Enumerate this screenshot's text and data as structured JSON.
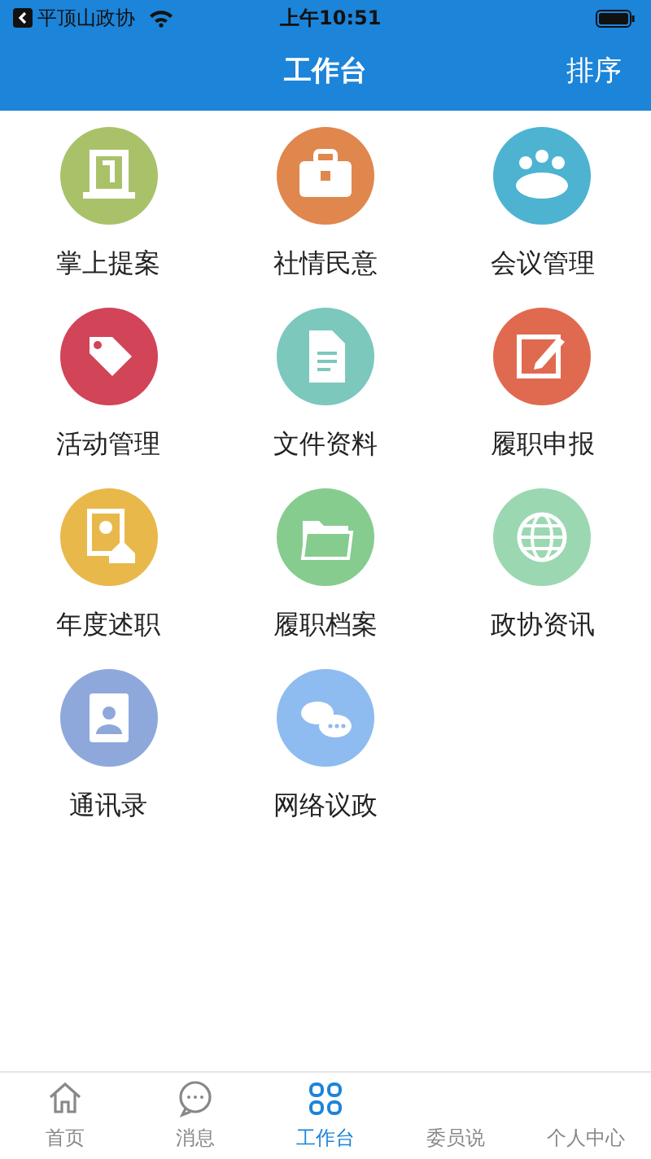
{
  "status_bar": {
    "back_app": "平顶山政协",
    "time": "上午10:51"
  },
  "nav": {
    "title": "工作台",
    "action": "排序"
  },
  "tiles": [
    {
      "label": "掌上提案",
      "kind": "podium",
      "color": "#a9c26a"
    },
    {
      "label": "社情民意",
      "kind": "briefcase",
      "color": "#e0874d"
    },
    {
      "label": "会议管理",
      "kind": "people",
      "color": "#4db3d1"
    },
    {
      "label": "活动管理",
      "kind": "tag",
      "color": "#d24458"
    },
    {
      "label": "文件资料",
      "kind": "document",
      "color": "#7cc8bd"
    },
    {
      "label": "履职申报",
      "kind": "edit",
      "color": "#e06a4f"
    },
    {
      "label": "年度述职",
      "kind": "portrait",
      "color": "#e9b84a"
    },
    {
      "label": "履职档案",
      "kind": "folder",
      "color": "#86cc8e"
    },
    {
      "label": "政协资讯",
      "kind": "globe",
      "color": "#9bd8b2"
    },
    {
      "label": "通讯录",
      "kind": "contacts",
      "color": "#8fa8dc"
    },
    {
      "label": "网络议政",
      "kind": "chat",
      "color": "#8ebbf0"
    }
  ],
  "tab_bar": [
    {
      "label": "首页",
      "kind": "home",
      "selected": false
    },
    {
      "label": "消息",
      "kind": "chat",
      "selected": false
    },
    {
      "label": "工作台",
      "kind": "grid",
      "selected": true
    },
    {
      "label": "委员说",
      "selected": false
    },
    {
      "label": "个人中心",
      "selected": false
    }
  ]
}
